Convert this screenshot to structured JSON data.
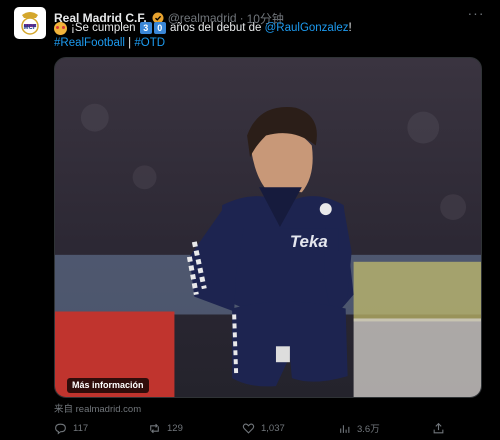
{
  "tweet": {
    "author_name": "Real Madrid C.F.",
    "handle": "@realmadrid",
    "separator": "·",
    "time": "10分钟",
    "more_label": "···",
    "text_prefix": "¡Se cumplen",
    "digit1": "3",
    "digit2": "0",
    "text_middle": "años del debut de",
    "mention": "@RaulGonzalez",
    "text_end": "!",
    "hashtag1": "#RealFootball",
    "pipe": "|",
    "hashtag2": "#OTD"
  },
  "media": {
    "info_button": "Más información",
    "shirt_sponsor": "Teka",
    "colors": {
      "background": "#2a2630",
      "kit": "#1d2450"
    }
  },
  "source": "来自 realmadrid.com",
  "actions": {
    "replies": "117",
    "retweets": "129",
    "likes": "1,037",
    "views": "3.6万"
  },
  "colors": {
    "accent": "#1d9bf0",
    "muted": "#71767b",
    "text": "#e7e9ea",
    "background": "#000000"
  }
}
